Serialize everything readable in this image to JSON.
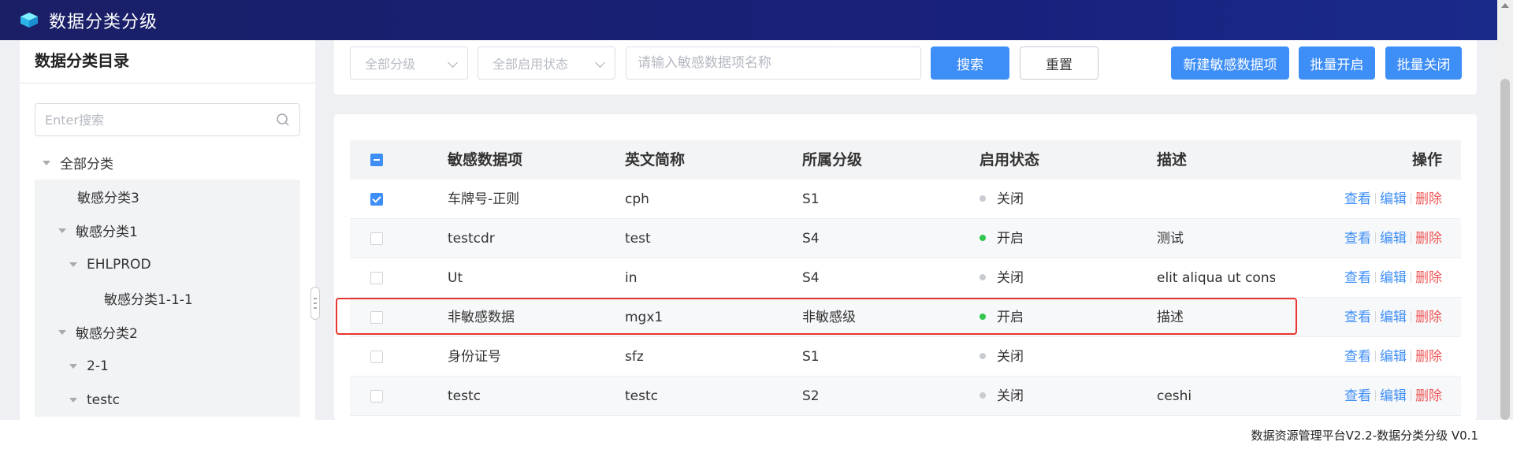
{
  "header": {
    "title": "数据分类分级"
  },
  "sidebar": {
    "title": "数据分类目录",
    "search_placeholder": "Enter搜索",
    "tree": [
      {
        "label": "全部分类",
        "level": 0,
        "caret": true,
        "highlight": false
      },
      {
        "label": "敏感分类3",
        "level": 1,
        "caret": false,
        "highlight": true
      },
      {
        "label": "敏感分类1",
        "level": 1,
        "caret": true,
        "highlight": true
      },
      {
        "label": "EHLPROD",
        "level": 2,
        "caret": true,
        "highlight": true
      },
      {
        "label": "敏感分类1-1-1",
        "level": 3,
        "caret": false,
        "highlight": true
      },
      {
        "label": "敏感分类2",
        "level": 1,
        "caret": true,
        "highlight": true
      },
      {
        "label": "2-1",
        "level": 2,
        "caret": true,
        "highlight": true
      },
      {
        "label": "testc",
        "level": 2,
        "caret": true,
        "highlight": true
      }
    ]
  },
  "filters": {
    "level_select": "全部分级",
    "status_select": "全部启用状态",
    "keyword_placeholder": "请输入敏感数据项名称",
    "search_label": "搜索",
    "reset_label": "重置",
    "new_label": "新建敏感数据项",
    "batch_on_label": "批量开启",
    "batch_off_label": "批量关闭"
  },
  "table": {
    "columns": {
      "name": "敏感数据项",
      "abbr": "英文简称",
      "level": "所属分级",
      "status": "启用状态",
      "desc": "描述",
      "ops": "操作"
    },
    "rows": [
      {
        "name": "车牌号-正则",
        "abbr": "cph",
        "level": "S1",
        "status": "关闭",
        "status_on": false,
        "desc": "",
        "checked": true
      },
      {
        "name": "testcdr",
        "abbr": "test",
        "level": "S4",
        "status": "开启",
        "status_on": true,
        "desc": "测试",
        "checked": false
      },
      {
        "name": "Ut",
        "abbr": "in",
        "level": "S4",
        "status": "关闭",
        "status_on": false,
        "desc": "elit aliqua ut conse...",
        "checked": false
      },
      {
        "name": "非敏感数据",
        "abbr": "mgx1",
        "level": "非敏感级",
        "status": "开启",
        "status_on": true,
        "desc": "描述",
        "checked": false
      },
      {
        "name": "身份证号",
        "abbr": "sfz",
        "level": "S1",
        "status": "关闭",
        "status_on": false,
        "desc": "",
        "checked": false
      },
      {
        "name": "testc",
        "abbr": "testc",
        "level": "S2",
        "status": "关闭",
        "status_on": false,
        "desc": "ceshi",
        "checked": false
      }
    ],
    "ops": {
      "view": "查看",
      "edit": "编辑",
      "delete": "删除"
    }
  },
  "colors": {
    "on": "#30c74c",
    "off": "#c8cbd0",
    "link": "#3e8ef7",
    "danger": "#f05656",
    "highlight_border": "#e8352f"
  },
  "footer": {
    "version_text": "数据资源管理平台V2.2-数据分类分级 V0.1"
  }
}
